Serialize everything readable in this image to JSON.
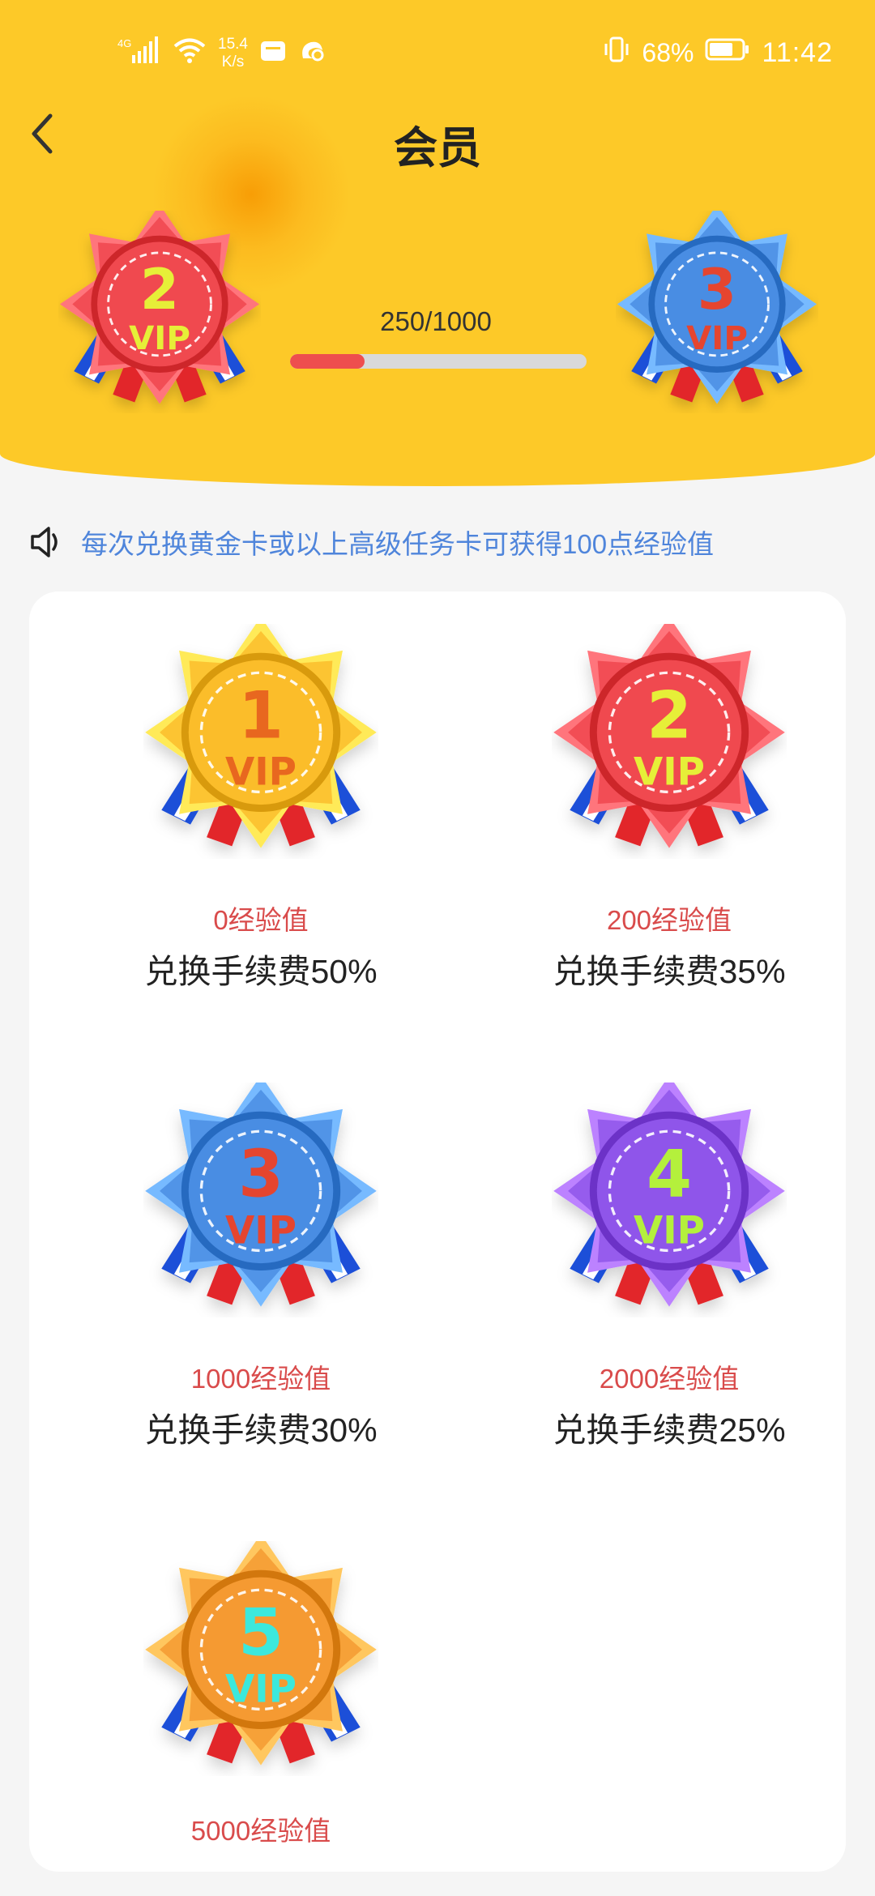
{
  "status_bar": {
    "network": "4G",
    "speed_value": "15.4",
    "speed_unit": "K/s",
    "battery_percent": "68%",
    "time": "11:42"
  },
  "nav": {
    "title": "会员"
  },
  "progress": {
    "current_level": "2",
    "next_level": "3",
    "text": "250/1000",
    "fraction": 0.25
  },
  "notice": {
    "text": "每次兑换黄金卡或以上高级任务卡可获得100点经验值"
  },
  "levels": [
    {
      "level": "1",
      "exp": "0经验值",
      "fee": "兑换手续费50%",
      "color": "#fbbd2c",
      "number_color": "#e8671f",
      "vip_color": "#e8671f"
    },
    {
      "level": "2",
      "exp": "200经验值",
      "fee": "兑换手续费35%",
      "color": "#f0484f",
      "number_color": "#e6ef38",
      "vip_color": "#e6ef38"
    },
    {
      "level": "3",
      "exp": "1000经验值",
      "fee": "兑换手续费30%",
      "color": "#4a8de3",
      "number_color": "#e5452f",
      "vip_color": "#e5452f"
    },
    {
      "level": "4",
      "exp": "2000经验值",
      "fee": "兑换手续费25%",
      "color": "#8f55ea",
      "number_color": "#b4f03c",
      "vip_color": "#b4f03c"
    },
    {
      "level": "5",
      "exp": "5000经验值",
      "fee": "",
      "color": "#f59a32",
      "number_color": "#3ce8dc",
      "vip_color": "#3ce8dc"
    }
  ],
  "vip_label": "VIP"
}
